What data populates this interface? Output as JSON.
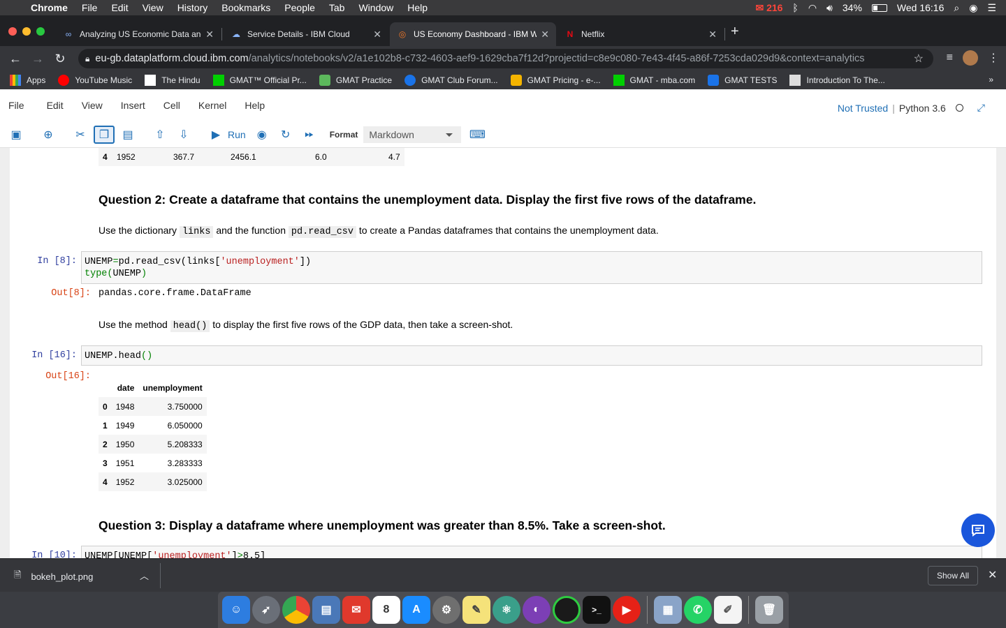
{
  "menubar": {
    "app": "Chrome",
    "items": [
      "File",
      "Edit",
      "View",
      "History",
      "Bookmarks",
      "People",
      "Tab",
      "Window",
      "Help"
    ],
    "mail_count": "216",
    "battery": "34%",
    "clock": "Wed 16:16"
  },
  "tabs": [
    {
      "title": "Analyzing US Economic Data and",
      "icon": "infinity-icon",
      "color": "#8ab4f8"
    },
    {
      "title": "Service Details - IBM Cloud",
      "icon": "cloud-icon",
      "color": "#8ab4f8"
    },
    {
      "title": "US Economy Dashboard - IBM W",
      "icon": "jupyter-icon",
      "color": "#f37726"
    },
    {
      "title": "Netflix",
      "icon": "netflix-icon",
      "color": "#e50914"
    }
  ],
  "address": {
    "host": "eu-gb.dataplatform.cloud.ibm.com",
    "path": "/analytics/notebooks/v2/a1e102b8-c732-4603-aef9-1629cba7f12d?projectid=c8e9c080-7e43-4f45-a86f-7253cda029d9&context=analytics"
  },
  "bookmarks": [
    {
      "label": "Apps",
      "color": "#4285f4"
    },
    {
      "label": "YouTube Music",
      "color": "#ff0000"
    },
    {
      "label": "The Hindu",
      "color": "#ffffff"
    },
    {
      "label": "GMAT™ Official Pr...",
      "color": "#00d000"
    },
    {
      "label": "GMAT Practice",
      "color": "#5cb85c"
    },
    {
      "label": "GMAT Club Forum...",
      "color": "#1a73e8"
    },
    {
      "label": "GMAT Pricing - e-...",
      "color": "#f4b400"
    },
    {
      "label": "GMAT - mba.com",
      "color": "#00d000"
    },
    {
      "label": "GMAT TESTS",
      "color": "#1a73e8"
    },
    {
      "label": "Introduction To The...",
      "color": "#dddddd"
    }
  ],
  "jupyter": {
    "menu": [
      "File",
      "Edit",
      "View",
      "Insert",
      "Cell",
      "Kernel",
      "Help"
    ],
    "not_trusted": "Not Trusted",
    "kernel": "Python 3.6",
    "run_label": "Run",
    "format_label": "Format",
    "format_value": "Markdown"
  },
  "prev_row": {
    "idx": "4",
    "cols": [
      "1952",
      "367.7",
      "2456.1",
      "6.0",
      "4.7"
    ]
  },
  "q2": {
    "heading": "Question 2: Create a dataframe that contains the unemployment data. Display the first five rows of the dataframe.",
    "p1_a": "Use the dictionary",
    "p1_code1": "links",
    "p1_b": "and the function",
    "p1_code2": "pd.read_csv",
    "p1_c": "to create a Pandas dataframes that contains the unemployment data."
  },
  "cell8": {
    "in_prompt": "In [8]:",
    "out_prompt": "Out[8]:",
    "output": "pandas.core.frame.DataFrame"
  },
  "p2": {
    "a": "Use the method",
    "code": "head()",
    "b": "to display the first five rows of the GDP data, then take a screen-shot."
  },
  "cell16": {
    "in_prompt": "In [16]:",
    "out_prompt": "Out[16]:",
    "code": "UNEMP.head()"
  },
  "df": {
    "columns": [
      "date",
      "unemployment"
    ],
    "rows": [
      {
        "idx": "0",
        "date": "1948",
        "val": "3.750000"
      },
      {
        "idx": "1",
        "date": "1949",
        "val": "6.050000"
      },
      {
        "idx": "2",
        "date": "1950",
        "val": "5.208333"
      },
      {
        "idx": "3",
        "date": "1951",
        "val": "3.283333"
      },
      {
        "idx": "4",
        "date": "1952",
        "val": "3.025000"
      }
    ]
  },
  "q3": {
    "heading": "Question 3: Display a dataframe where unemployment was greater than 8.5%. Take a screen-shot.",
    "in_prompt": "In [10]:"
  },
  "download": {
    "filename": "bokeh_plot.png",
    "show_all": "Show All"
  },
  "dock": [
    "Finder",
    "Launchpad",
    "Chrome",
    "Preview",
    "Mail",
    "Calendar",
    "App Store",
    "System Preferences",
    "Stickies",
    "Atom",
    "GitHub",
    "Activity",
    "Terminal",
    "YouTube Music",
    "Photos",
    "WhatsApp",
    "TextEdit",
    "Trash"
  ]
}
